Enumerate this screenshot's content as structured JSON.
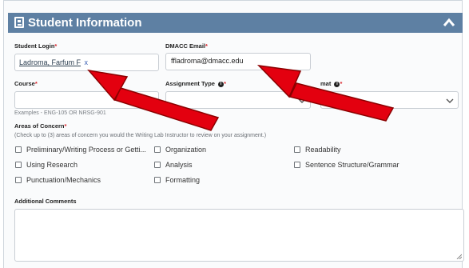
{
  "panel": {
    "title": "Student Information"
  },
  "student_login": {
    "label": "Student Login",
    "required_mark": "*",
    "value": "Ladroma, Farfum F",
    "clear_mark": "x"
  },
  "dmacc_email": {
    "label": "DMACC Email",
    "required_mark": "*",
    "value": "ffladroma@dmacc.edu"
  },
  "course": {
    "label": "Course",
    "required_mark": "*",
    "value": "",
    "hint": "Examples - ENG-105 OR NRSG-901"
  },
  "assignment_type": {
    "label": "Assignment Type",
    "required_mark": "*",
    "info_mark": "i",
    "value": ""
  },
  "format": {
    "label": "mat",
    "required_mark": "*",
    "info_mark": "i",
    "value": ""
  },
  "areas": {
    "label": "Areas of Concern",
    "required_mark": "*",
    "instruction": "(Check up to (3) areas of concern you would the Writing Lab Instructor to review on your assignment.)",
    "options": [
      "Preliminary/Writing Process or Getti...",
      "Organization",
      "Readability",
      "Using Research",
      "Analysis",
      "Sentence Structure/Grammar",
      "Punctuation/Mechanics",
      "Formatting"
    ]
  },
  "comments": {
    "label": "Additional Comments",
    "value": ""
  },
  "colors": {
    "header": "#5e80a3",
    "required": "#d9262c",
    "arrow": "#e3000f"
  },
  "icons": {
    "panel": "document-icon",
    "collapse": "chevron-up-icon",
    "dropdown": "chevron-down-icon",
    "info": "info-icon",
    "resize": "resize-handle-icon"
  }
}
